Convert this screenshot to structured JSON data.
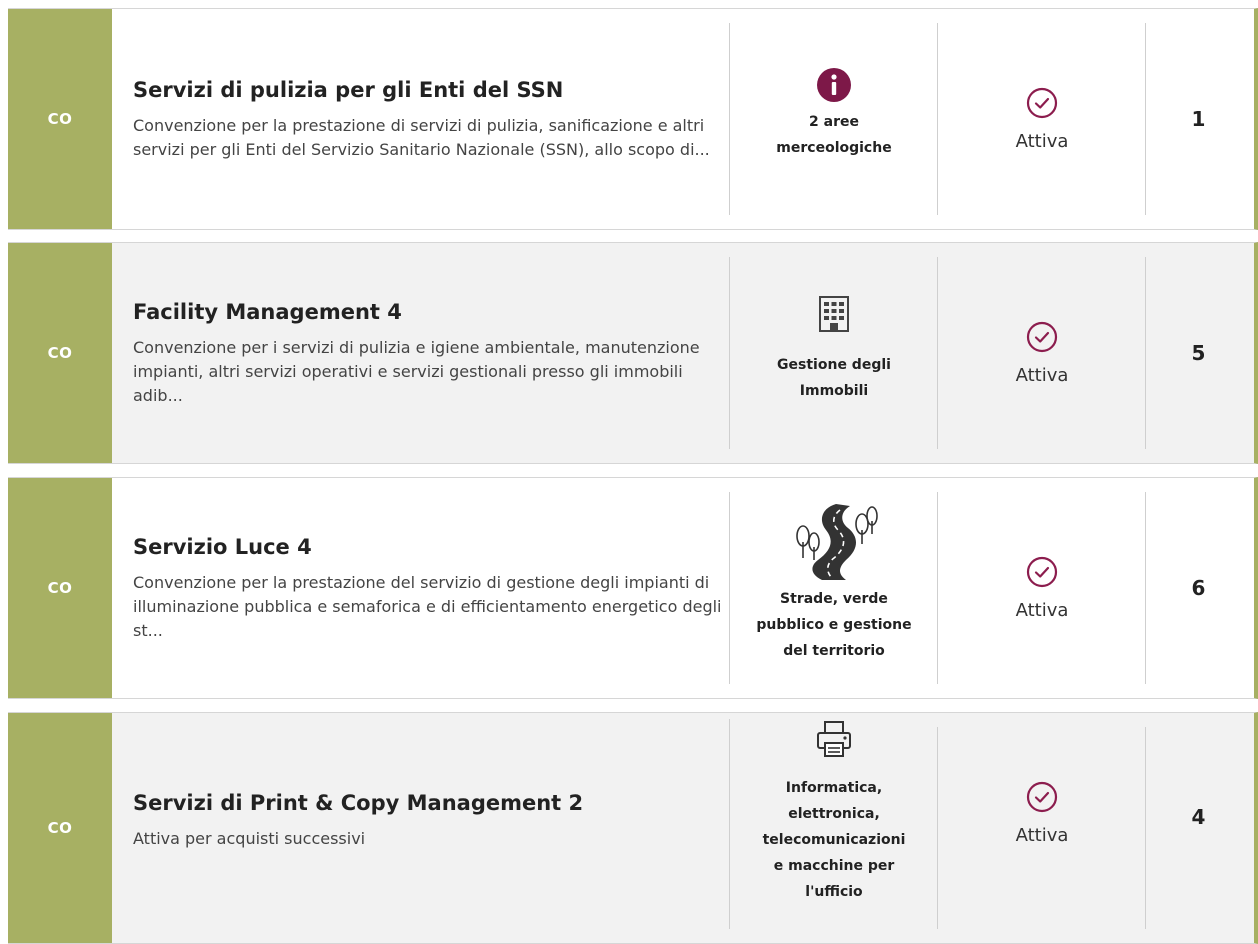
{
  "accent_color": "#a7b063",
  "status_icon_color": "#8c1d4e",
  "cards": [
    {
      "badge": "CO",
      "title": "Servizi di pulizia per gli Enti del SSN",
      "description": "Convenzione per la prestazione di servizi di pulizia, sanificazione e altri servizi per gli Enti del Servizio Sanitario Nazionale (SSN), allo scopo di...",
      "category_icon": "info-icon",
      "category": "2 aree merceologiche",
      "status": "Attiva",
      "status_icon": "check-circle-icon",
      "count": "1"
    },
    {
      "badge": "CO",
      "title": "Facility Management 4",
      "description": "Convenzione per i servizi di pulizia e igiene ambientale, manutenzione impianti, altri servizi operativi e servizi gestionali presso gli immobili adib...",
      "category_icon": "building-icon",
      "category": "Gestione degli Immobili",
      "status": "Attiva",
      "status_icon": "check-circle-icon",
      "count": "5"
    },
    {
      "badge": "CO",
      "title": "Servizio Luce 4",
      "description": "Convenzione per la prestazione del servizio di gestione degli impianti di illuminazione pubblica e semaforica e di efficientamento energetico degli st...",
      "category_icon": "road-trees-icon",
      "category": "Strade, verde pubblico e gestione del territorio",
      "status": "Attiva",
      "status_icon": "check-circle-icon",
      "count": "6"
    },
    {
      "badge": "CO",
      "title": "Servizi di Print & Copy Management 2",
      "description": "Attiva per acquisti successivi",
      "category_icon": "printer-icon",
      "category": "Informatica, elettronica, telecomunicazioni e macchine per l'ufficio",
      "status": "Attiva",
      "status_icon": "check-circle-icon",
      "count": "4"
    }
  ]
}
